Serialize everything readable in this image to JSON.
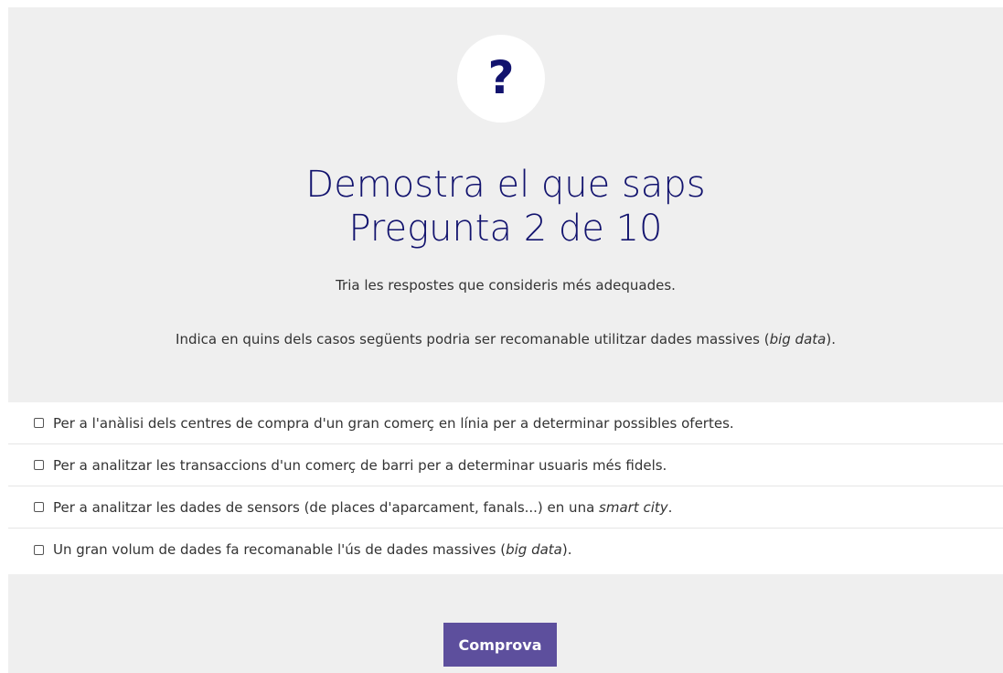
{
  "header": {
    "icon_glyph": "?",
    "title_line1": "Demostra el que saps",
    "title_line2": "Pregunta 2 de 10",
    "instruction": "Tria les respostes que consideris més adequades.",
    "question_prefix": "Indica en quins dels casos següents podria ser recomanable utilitzar dades massives (",
    "question_italic": "big data",
    "question_suffix": ")."
  },
  "options": [
    {
      "text": "Per a l'anàlisi dels centres de compra d'un gran comerç en línia per a determinar possibles ofertes.",
      "italic": "",
      "suffix": "",
      "checked": false
    },
    {
      "text": "Per a analitzar les transaccions d'un comerç de barri per a determinar usuaris més fidels.",
      "italic": "",
      "suffix": "",
      "checked": false
    },
    {
      "text": "Per a analitzar les dades de sensors (de places d'aparcament, fanals...) en una ",
      "italic": "smart city",
      "suffix": ".",
      "checked": false
    },
    {
      "text": "Un gran volum de dades fa recomanable l'ús de dades massives (",
      "italic": "big data",
      "suffix": ").",
      "checked": false
    }
  ],
  "footer": {
    "check_label": "Comprova"
  },
  "colors": {
    "title": "#12136e",
    "panel_bg": "#efefef",
    "button_bg": "#5d4f9d",
    "button_text": "#ffffff"
  }
}
